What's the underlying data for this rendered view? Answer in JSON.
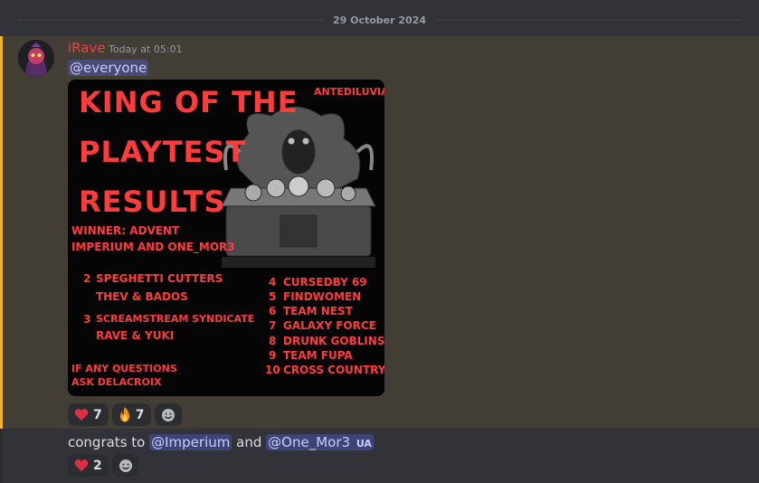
{
  "divider": {
    "date": "29 October 2024"
  },
  "message1": {
    "username": "iRave",
    "timestamp": "Today at 05:01",
    "mention": "@everyone",
    "poster": {
      "tag": "ANTEDILUVIAN",
      "title1": "KING OF THE",
      "title2": "PLAYTEST",
      "title3": "RESULTS",
      "winner1": "WINNER: ADVENT",
      "winner2": "IMPERIUM AND ONE_MOR3",
      "rank2_num": "2",
      "rank2_team": "SPEGHETTI CUTTERS",
      "rank2_players": "THEV & BADOS",
      "rank3_num": "3",
      "rank3_team": "SCREAMSTREAM SYNDICATE",
      "rank3_players": "RAVE & YUKI",
      "questions1": "IF ANY QUESTIONS",
      "questions2": "ASK DELACROIX",
      "ranks": [
        {
          "n": "4",
          "team": "CURSEDBY 69"
        },
        {
          "n": "5",
          "team": "FINDWOMEN"
        },
        {
          "n": "6",
          "team": "TEAM NEST"
        },
        {
          "n": "7",
          "team": "GALAXY FORCE"
        },
        {
          "n": "8",
          "team": "DRUNK GOBLINS"
        },
        {
          "n": "9",
          "team": "TEAM FUPA"
        },
        {
          "n": "10",
          "team": "CROSS COUNTRY"
        }
      ]
    },
    "reactions": [
      {
        "emoji": "heart-icon",
        "count": "7"
      },
      {
        "emoji": "fire-icon",
        "count": "7"
      }
    ]
  },
  "message2": {
    "text_before": "congrats to",
    "mention1": "@Imperium",
    "text_mid": "and",
    "mention2": "@One_Mor3",
    "tag": "UA",
    "reactions": [
      {
        "emoji": "heart-icon",
        "count": "2"
      }
    ]
  },
  "colors": {
    "username": "#f23f43",
    "highlight_bar": "#f0b132",
    "poster_text": "#ff3c3c"
  }
}
